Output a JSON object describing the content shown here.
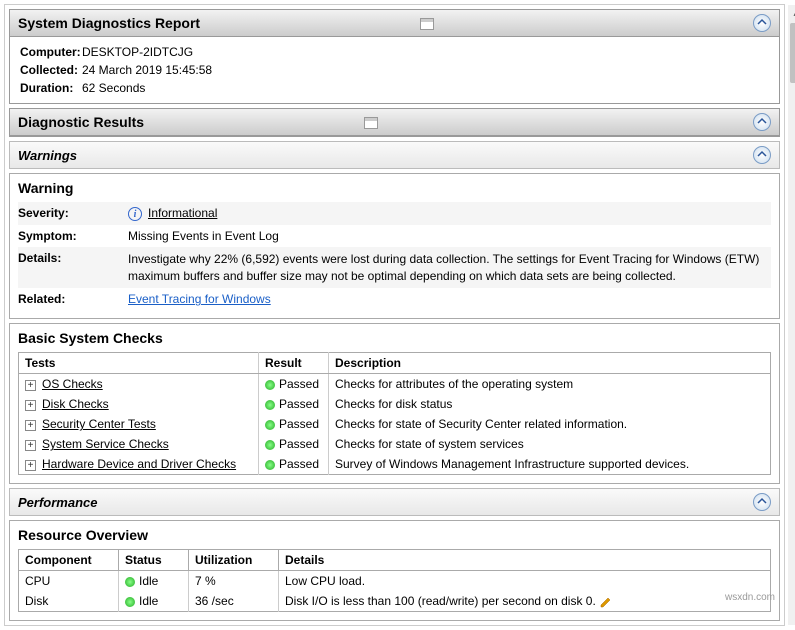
{
  "header1": {
    "title": "System Diagnostics Report",
    "computer_label": "Computer:",
    "computer_value": "DESKTOP-2IDTCJG",
    "collected_label": "Collected:",
    "collected_value": "24 March 2019 15:45:58",
    "duration_label": "Duration:",
    "duration_value": "62 Seconds"
  },
  "header2": {
    "title": "Diagnostic Results"
  },
  "warnings_header": {
    "title": "Warnings"
  },
  "warning": {
    "title": "Warning",
    "severity_label": "Severity:",
    "severity_value": "Informational",
    "symptom_label": "Symptom:",
    "symptom_value": "Missing Events in Event Log",
    "details_label": "Details:",
    "details_value": "Investigate why 22% (6,592) events were lost during data collection. The settings for Event Tracing for Windows (ETW) maximum buffers and buffer size may not be optimal depending on which data sets are being collected.",
    "related_label": "Related:",
    "related_value": "Event Tracing for Windows"
  },
  "checks": {
    "title": "Basic System Checks",
    "col_tests": "Tests",
    "col_result": "Result",
    "col_desc": "Description",
    "rows": [
      {
        "name": "OS Checks",
        "result": "Passed",
        "desc": "Checks for attributes of the operating system"
      },
      {
        "name": "Disk Checks",
        "result": "Passed",
        "desc": "Checks for disk status"
      },
      {
        "name": "Security Center Tests",
        "result": "Passed",
        "desc": "Checks for state of Security Center related information."
      },
      {
        "name": "System Service Checks",
        "result": "Passed",
        "desc": "Checks for state of system services"
      },
      {
        "name": "Hardware Device and Driver Checks",
        "result": "Passed",
        "desc": "Survey of Windows Management Infrastructure supported devices."
      }
    ]
  },
  "performance_header": {
    "title": "Performance"
  },
  "resource": {
    "title": "Resource Overview",
    "col_component": "Component",
    "col_status": "Status",
    "col_util": "Utilization",
    "col_details": "Details",
    "rows": [
      {
        "component": "CPU",
        "status": "Idle",
        "util": "7 %",
        "details": "Low CPU load."
      },
      {
        "component": "Disk",
        "status": "Idle",
        "util": "36 /sec",
        "details": "Disk I/O is less than 100 (read/write) per second on disk 0."
      }
    ]
  },
  "watermark": "wsxdn.com"
}
